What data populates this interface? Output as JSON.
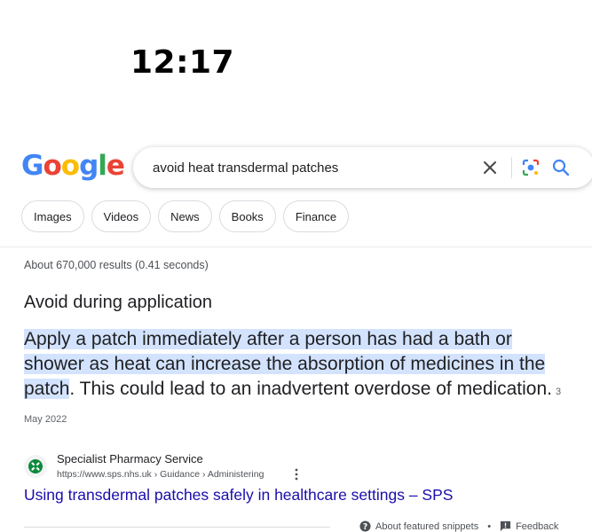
{
  "status_bar": {
    "time": "12:17"
  },
  "logo": {
    "letters": [
      "G",
      "o",
      "o",
      "g",
      "l",
      "e"
    ],
    "colors": [
      "#4285F4",
      "#EA4335",
      "#FBBC05",
      "#4285F4",
      "#34A853",
      "#EA4335"
    ]
  },
  "search": {
    "query": "avoid heat transdermal patches"
  },
  "filters": [
    "Images",
    "Videos",
    "News",
    "Books",
    "Finance"
  ],
  "results_stats": "About 670,000 results (0.41 seconds)",
  "featured_snippet": {
    "heading": "Avoid during application",
    "highlighted_text": "Apply a patch immediately after a person has had a bath or shower as heat can increase the absorption of medicines in the patch",
    "rest_text": ". This could lead to an inadvertent overdose of medication.",
    "date": "3 May 2022"
  },
  "source": {
    "site_name": "Specialist Pharmacy Service",
    "url": "https://www.sps.nhs.uk › Guidance › Administering",
    "title": "Using transdermal patches safely in healthcare settings – SPS"
  },
  "footer": {
    "about_label": "About featured snippets",
    "separator": "•",
    "feedback_label": "Feedback"
  },
  "colors": {
    "link": "#1a0dab",
    "highlight": "#d3e3fd"
  }
}
